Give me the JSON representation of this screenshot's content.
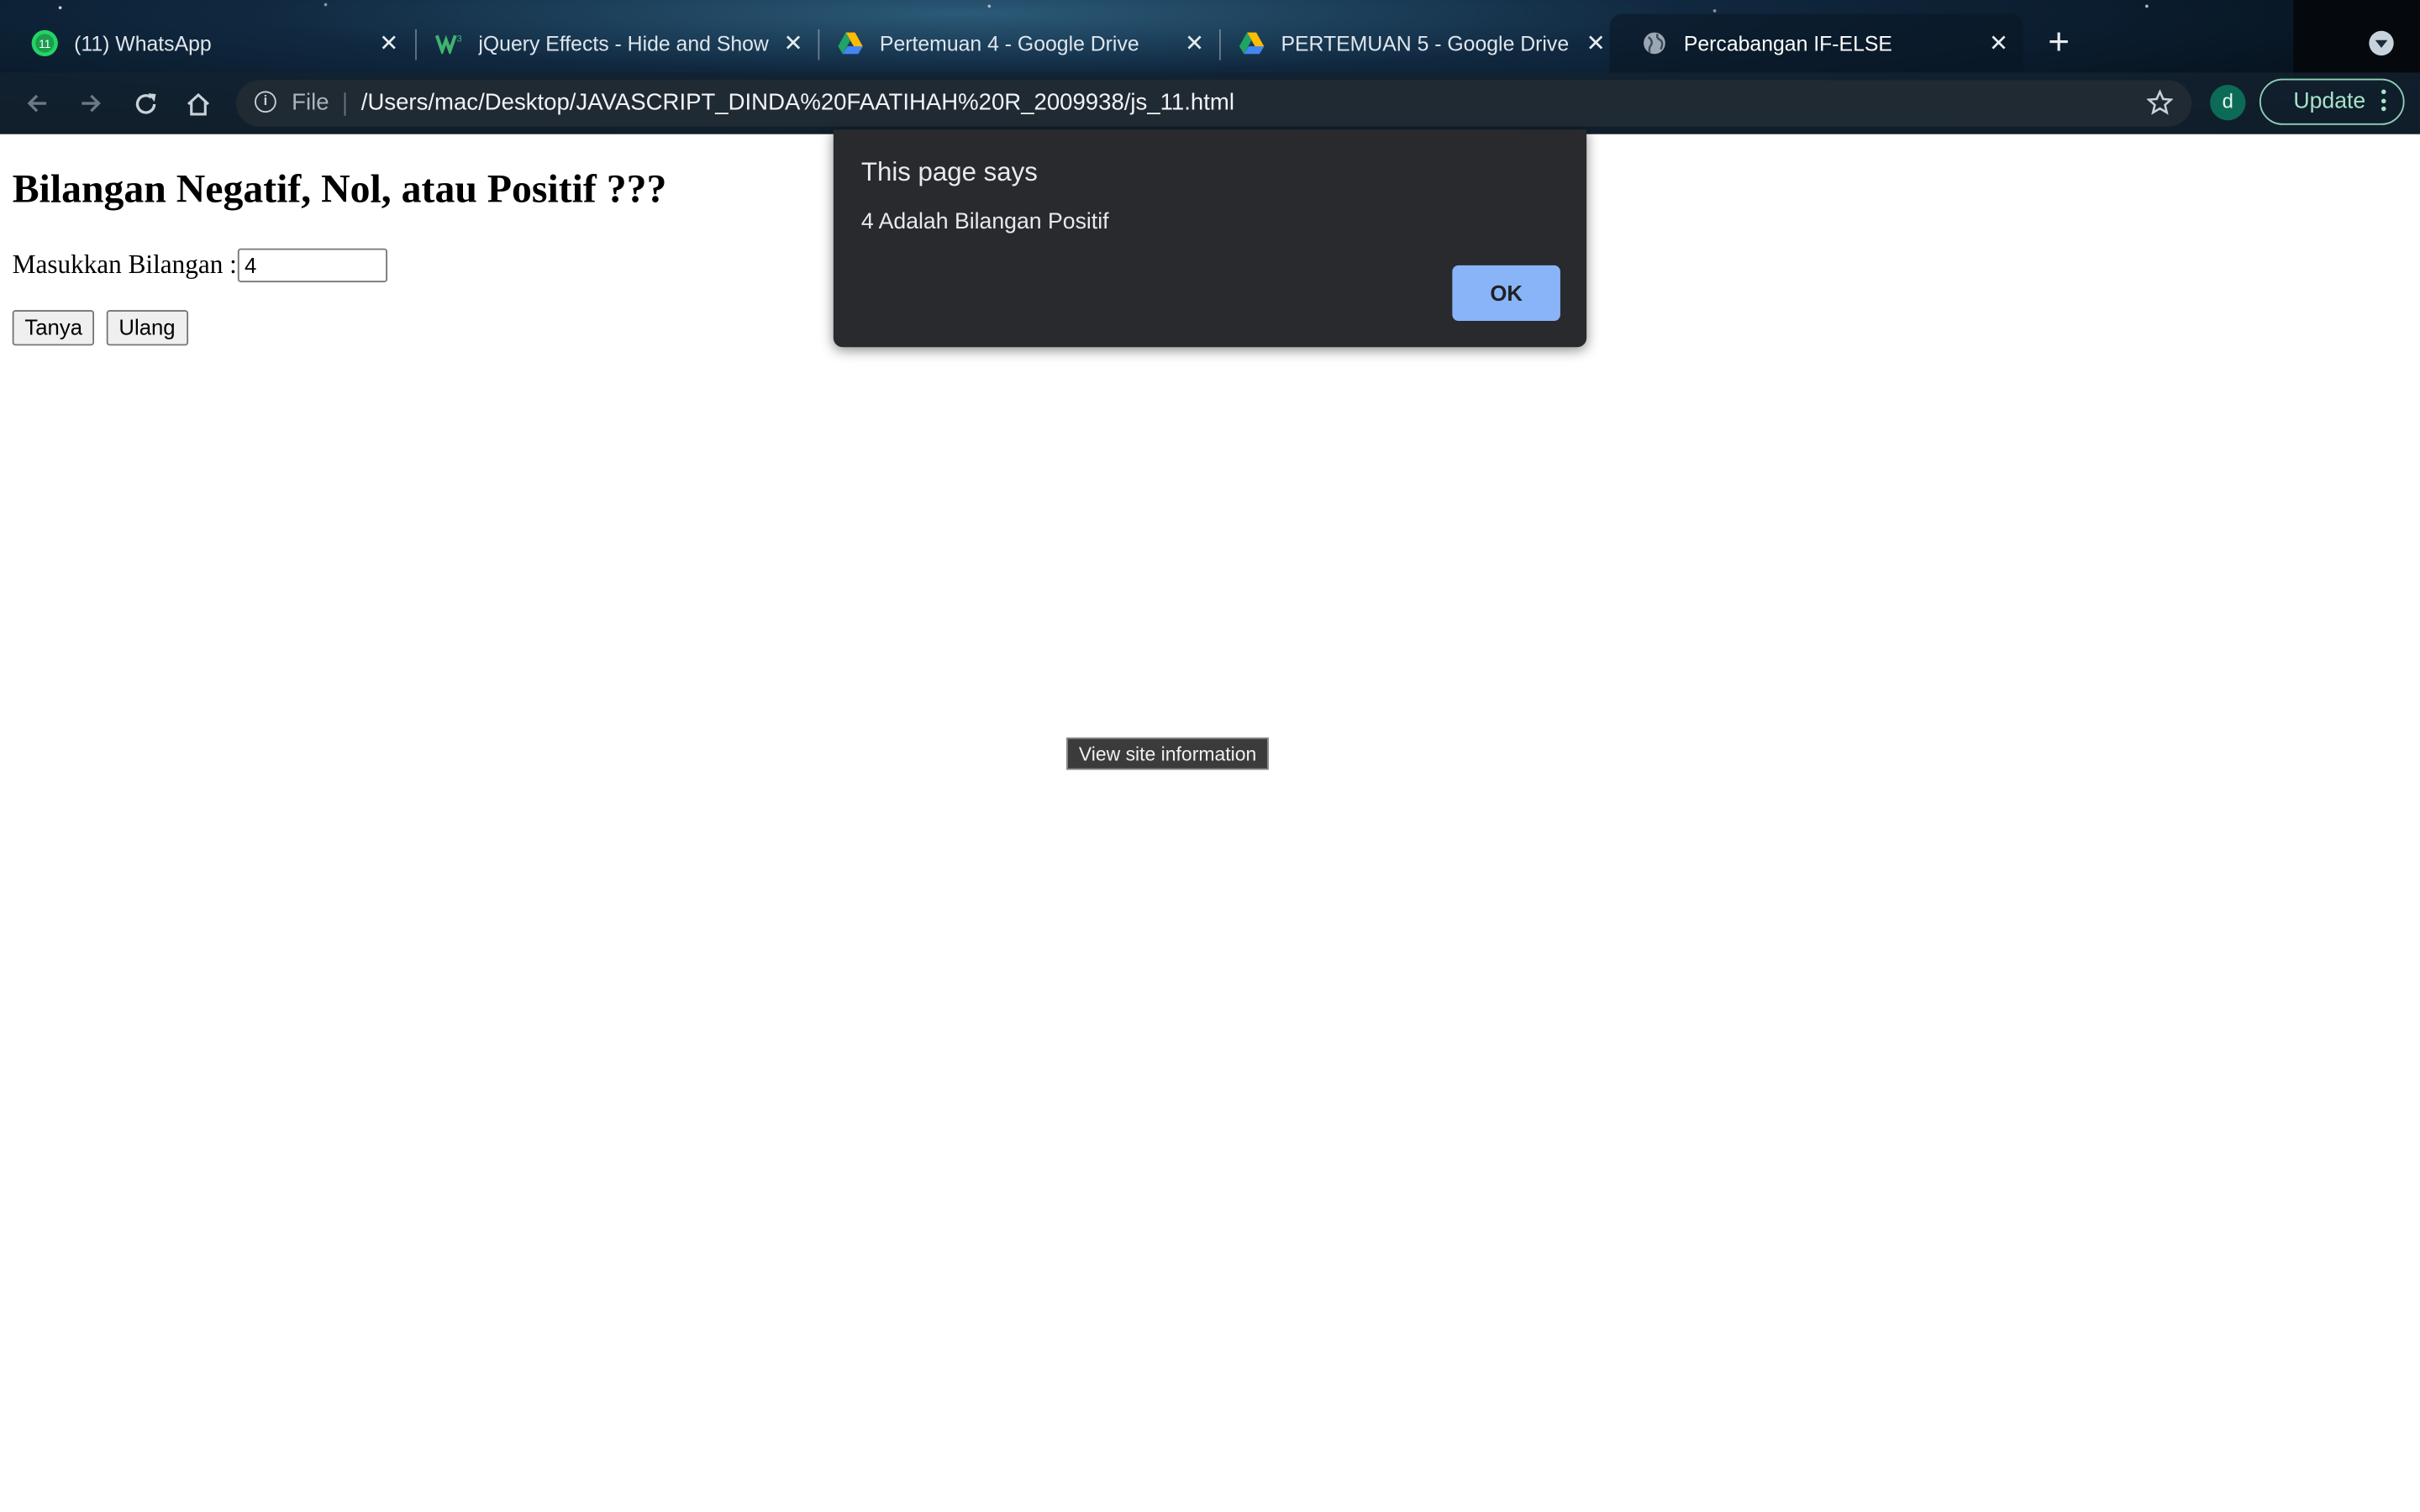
{
  "browser": {
    "tabs": [
      {
        "title": "(11) WhatsApp",
        "favicon": "whatsapp-icon",
        "badge": "11"
      },
      {
        "title": "jQuery Effects - Hide and Show",
        "favicon": "w3schools-icon"
      },
      {
        "title": "Pertemuan 4 - Google Drive",
        "favicon": "google-drive-icon"
      },
      {
        "title": "PERTEMUAN 5 - Google Drive",
        "favicon": "google-drive-icon"
      },
      {
        "title": "Percabangan IF-ELSE",
        "favicon": "globe-icon",
        "active": true
      }
    ],
    "omnibox": {
      "scheme_label": "File",
      "url": "/Users/mac/Desktop/JAVASCRIPT_DINDA%20FAATIHAH%20R_2009938/js_11.html"
    },
    "profile_initial": "d",
    "update_label": "Update"
  },
  "page": {
    "heading": "Bilangan Negatif, Nol, atau Positif ???",
    "input_label": "Masukkan Bilangan :",
    "input_value": "4",
    "ask_button": "Tanya",
    "reset_button": "Ulang"
  },
  "tooltip": "View site information",
  "dialog": {
    "title": "This page says",
    "message": "4 Adalah Bilangan Positif",
    "ok_label": "OK"
  },
  "colors": {
    "dialog_bg": "#292a2d",
    "ok_button": "#8ab4f8",
    "update_accent": "#a6e3c9",
    "avatar_bg": "#0c6b57"
  }
}
